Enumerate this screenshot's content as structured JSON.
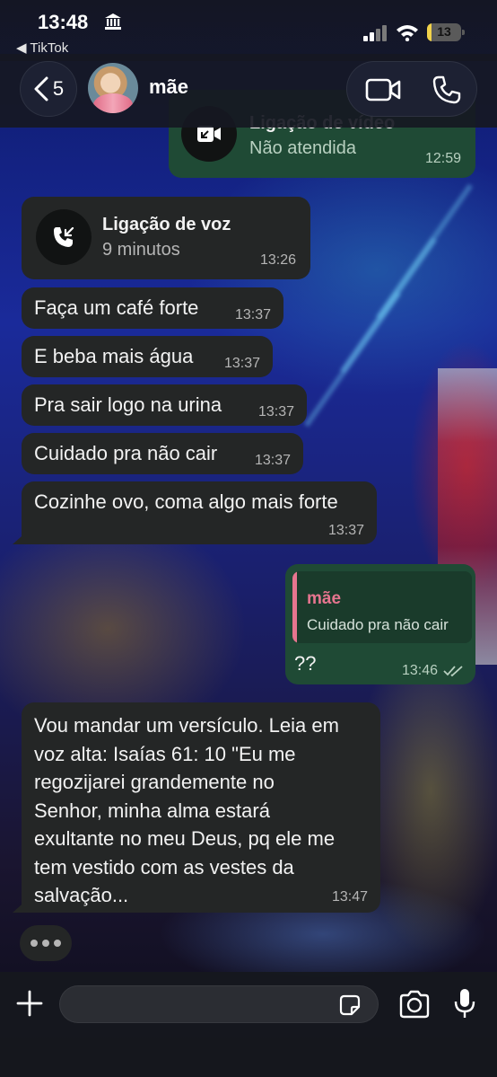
{
  "status_bar": {
    "time": "13:48",
    "back_app": "◀ TikTok",
    "battery": "13",
    "battery_level": 0.13
  },
  "header": {
    "back_count": "5",
    "contact_name": "mãe"
  },
  "messages": {
    "missed_video_call": {
      "title": "Ligação de vídeo",
      "status": "Não atendida",
      "time": "12:59"
    },
    "voice_call": {
      "title": "Ligação de voz",
      "duration": "9 minutos",
      "time": "13:26"
    },
    "m1": {
      "text": "Faça um café forte",
      "time": "13:37"
    },
    "m2": {
      "text": "E beba mais água",
      "time": "13:37"
    },
    "m3": {
      "text": "Pra sair logo na urina",
      "time": "13:37"
    },
    "m4": {
      "text": "Cuidado pra não cair",
      "time": "13:37"
    },
    "m5": {
      "text": "Cozinhe ovo, coma algo mais forte",
      "time": "13:37"
    },
    "reply": {
      "quoted_name": "mãe",
      "quoted_text": "Cuidado pra não cair",
      "text": "??",
      "time": "13:46"
    },
    "verse": {
      "lines": [
        "Vou mandar um versículo. Leia em",
        "voz alta: Isaías 61: 10 \"Eu me",
        "regozijarei grandemente no",
        "Senhor, minha alma estará",
        "exultante no meu Deus, pq ele me",
        "tem vestido com as vestes da",
        "salvação..."
      ],
      "time": "13:47"
    }
  },
  "input": {
    "placeholder": ""
  },
  "colors": {
    "incoming_bubble": "#242626",
    "outgoing_bubble": "#1f4a35",
    "quote_accent": "#e6758f",
    "battery": "#f2d34a"
  }
}
